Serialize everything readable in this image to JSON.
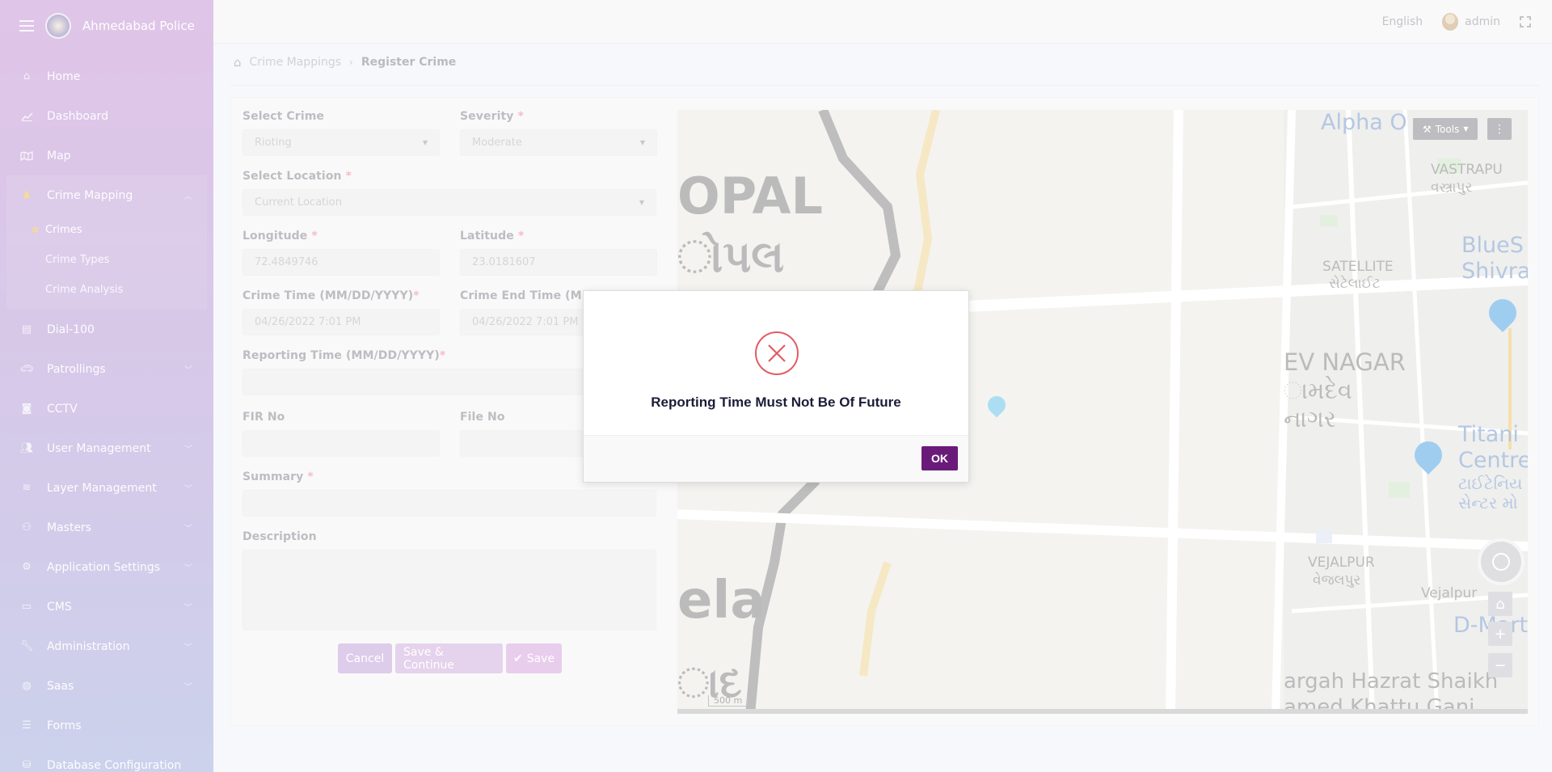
{
  "app": {
    "title": "Ahmedabad Police"
  },
  "header": {
    "language": "English",
    "user": "admin"
  },
  "sidebar": {
    "items": [
      {
        "label": "Home",
        "icon": "home-icon"
      },
      {
        "label": "Dashboard",
        "icon": "chart-line-icon"
      },
      {
        "label": "Map",
        "icon": "map-icon"
      },
      {
        "label": "Crime Mapping",
        "icon": "crime-mapping-icon",
        "expanded": true,
        "children": [
          {
            "label": "Crimes",
            "active": true
          },
          {
            "label": "Crime Types"
          },
          {
            "label": "Crime Analysis"
          }
        ]
      },
      {
        "label": "Dial-100",
        "icon": "file-icon"
      },
      {
        "label": "Patrollings",
        "icon": "car-icon"
      },
      {
        "label": "CCTV",
        "icon": "camera-icon"
      },
      {
        "label": "User Management",
        "icon": "users-icon"
      },
      {
        "label": "Layer Management",
        "icon": "layers-icon"
      },
      {
        "label": "Masters",
        "icon": "users-cog-icon"
      },
      {
        "label": "Application Settings",
        "icon": "gears-icon"
      },
      {
        "label": "CMS",
        "icon": "window-icon"
      },
      {
        "label": "Administration",
        "icon": "wrench-icon"
      },
      {
        "label": "Saas",
        "icon": "globe-icon"
      },
      {
        "label": "Forms",
        "icon": "list-icon"
      },
      {
        "label": "Database Configuration",
        "icon": "database-icon"
      }
    ]
  },
  "breadcrumb": {
    "parent": "Crime Mappings",
    "current": "Register Crime"
  },
  "form": {
    "select_crime": {
      "label": "Select Crime",
      "value": "Rioting"
    },
    "severity": {
      "label": "Severity",
      "value": "Moderate"
    },
    "select_location": {
      "label": "Select Location",
      "value": "Current Location"
    },
    "longitude": {
      "label": "Longitude",
      "value": "72.4849746"
    },
    "latitude": {
      "label": "Latitude",
      "value": "23.0181607"
    },
    "crime_time": {
      "label": "Crime Time (MM/DD/YYYY)",
      "value": "04/26/2022 7:01 PM"
    },
    "crime_end_time": {
      "label": "Crime End Time (MM/I",
      "value": "04/26/2022 7:01 PM"
    },
    "reporting_time": {
      "label": "Reporting Time (MM/DD/YYYY)",
      "value": ""
    },
    "fir_no": {
      "label": "FIR No",
      "value": ""
    },
    "file_no": {
      "label": "File No",
      "value": ""
    },
    "summary": {
      "label": "Summary",
      "value": ""
    },
    "description": {
      "label": "Description",
      "value": ""
    },
    "required_mark": "*",
    "buttons": {
      "cancel": "Cancel",
      "save_continue": "Save & Continue",
      "save": "Save"
    }
  },
  "map": {
    "tools_label": "Tools",
    "scale_label": "500 m",
    "labels": [
      "Alpha O",
      "VASTRAPU",
      "વસ્ત્રાપુર",
      "BlueS",
      "Shivra",
      "SATELLITE",
      "સેટેલાઈટ",
      "EV NAGAR",
      "ામદેવ",
      "નાગર",
      "Titani",
      "Centre",
      "ટાઈટેનિય",
      "સેન્ટર મો",
      "VEJALPUR",
      "વેજલપુર",
      "Vejalpur",
      "D-Mart",
      "argah Hazrat Shaikh",
      "amed Khattu Ganj",
      "OPAL",
      "ોપલ",
      "ela",
      "ાદ"
    ]
  },
  "modal": {
    "message": "Reporting Time Must Not Be Of Future",
    "ok_label": "OK",
    "icon": "error-x-icon"
  },
  "colors": {
    "accent": "#6a1b7a",
    "error": "#e25c63"
  }
}
